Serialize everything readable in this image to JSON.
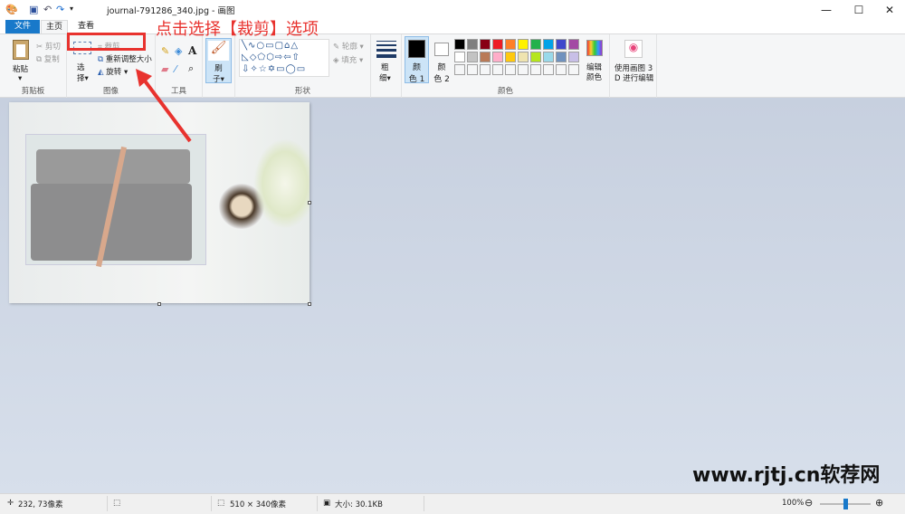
{
  "titlebar": {
    "title": "journal-791286_340.jpg - 画图",
    "minimize": "—",
    "maximize": "☐",
    "close": "✕"
  },
  "tabs": [
    {
      "label": "文件"
    },
    {
      "label": "主页"
    },
    {
      "label": "查看"
    }
  ],
  "clipboard": {
    "paste": "粘贴",
    "cut": "剪切",
    "copy": "复制",
    "group": "剪贴板"
  },
  "image": {
    "select1": "选",
    "select2": "择",
    "crop": "裁剪",
    "resize": "重新调整大小",
    "rotate": "旋转",
    "group": "图像"
  },
  "tools": {
    "group": "工具"
  },
  "brushes": {
    "label1": "刷",
    "label2": "子"
  },
  "shapes": {
    "outline": "轮廓",
    "fill": "填充",
    "group": "形状"
  },
  "size": {
    "label1": "粗",
    "label2": "细"
  },
  "colors": {
    "color1_a": "颜",
    "color1_b": "色 1",
    "color2_a": "颜",
    "color2_b": "色 2",
    "edit1": "编辑",
    "edit2": "颜色",
    "group": "颜色",
    "row1": [
      "#000000",
      "#7f7f7f",
      "#880015",
      "#ed1c24",
      "#ff7f27",
      "#fff200",
      "#22b14c",
      "#00a2e8",
      "#3f48cc",
      "#a349a4"
    ],
    "row2": [
      "#ffffff",
      "#c3c3c3",
      "#b97a57",
      "#ffaec9",
      "#ffc90e",
      "#efe4b0",
      "#b5e61d",
      "#99d9ea",
      "#7092be",
      "#c8bfe7"
    ]
  },
  "paint3d": {
    "label1": "使用画图 3",
    "label2": "D 进行编辑"
  },
  "annotation": {
    "text": "点击选择【裁剪】选项",
    "color": "#e8322e"
  },
  "status": {
    "position": "232, 73像素",
    "dimensions": "510 × 340像素",
    "filesize": "大小: 30.1KB",
    "zoom": "100%",
    "zoom_fraction": 0.5
  },
  "watermark": "www.rjtj.cn软荐网"
}
